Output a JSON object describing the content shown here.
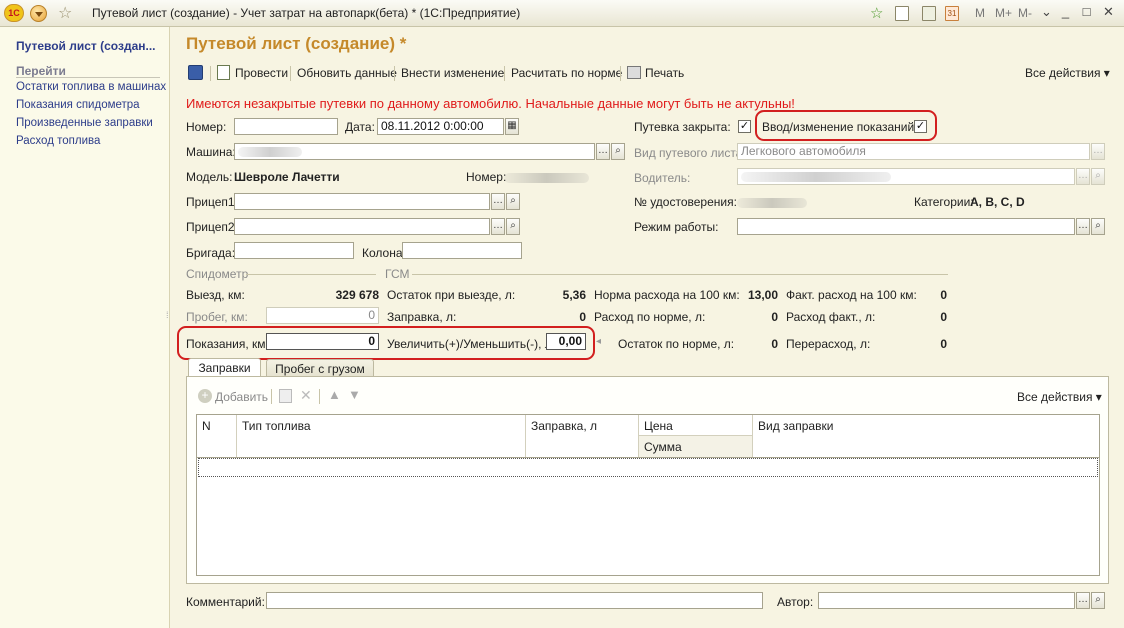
{
  "window": {
    "title": "Путевой лист (создание) - Учет затрат на автопарк(бета) *  (1С:Предприятие)",
    "logo": "1С",
    "right_icons": [
      "M",
      "M+",
      "M-"
    ]
  },
  "left_panel": {
    "current": "Путевой лист (создан...",
    "goto_header": "Перейти",
    "links": [
      "Остатки топлива в машинах",
      "Показания спидометра",
      "Произведенные заправки",
      "Расход топлива"
    ]
  },
  "form": {
    "title": "Путевой лист (создание) *",
    "toolbar": {
      "post": "Провести",
      "refresh": "Обновить данные",
      "change": "Внести изменение",
      "calc": "Расчитать по норме",
      "print": "Печать",
      "all_actions": "Все действия ▾"
    },
    "warning": "Имеются незакрытые путевки по данному автомобилю. Начальные данные могут быть не актульны!",
    "fields": {
      "number_label": "Номер:",
      "number_value": "",
      "date_label": "Дата:",
      "date_value": "08.11.2012  0:00:00",
      "closed_label": "Путевка закрыта:",
      "input_change_label": "Ввод/изменение показаний:",
      "car_label": "Машина:",
      "sheet_type_label": "Вид путевого листа:",
      "sheet_type_value": "Легкового автомобиля",
      "model_label": "Модель:",
      "model_value": "Шевроле Лачетти",
      "model_number_label": "Номер:",
      "driver_label": "Водитель:",
      "trailer1_label": "Прицеп1:",
      "trailer2_label": "Прицеп2:",
      "license_label": "№ удостоверения:",
      "categories_label": "Категории:",
      "categories_value": "A, B, C, D",
      "work_mode_label": "Режим работы:",
      "brigade_label": "Бригада:",
      "column_label": "Колона:"
    },
    "speedometer": {
      "header": "Спидометр",
      "departure_label": "Выезд, км:",
      "departure_value": "329 678",
      "mileage_label": "Пробег, км:",
      "mileage_value": "0",
      "reading_label": "Показания, км:",
      "reading_value": "0"
    },
    "gsm": {
      "header": "ГСМ",
      "rest_label": "Остаток при выезде, л:",
      "rest_value": "5,36",
      "fuel_label": "Заправка, л:",
      "fuel_value": "0",
      "incdec_label": "Увеличить(+)/Уменьшить(-), л:",
      "incdec_value": "0,00",
      "norm100_label": "Норма расхода на 100 км:",
      "norm100_value": "13,00",
      "bynorm_label": "Расход по норме, л:",
      "bynorm_value": "0",
      "restnorm_label": "Остаток по норме, л:",
      "restnorm_value": "0",
      "fact100_label": "Факт. расход на 100 км:",
      "fact100_value": "0",
      "fact_label": "Расход факт., л:",
      "fact_value": "0",
      "over_label": "Перерасход, л:",
      "over_value": "0"
    },
    "tabs": [
      "Заправки",
      "Пробег с грузом"
    ],
    "table": {
      "add_label": "Добавить",
      "all_actions": "Все действия ▾",
      "columns": {
        "n": "N",
        "fuel_type": "Тип топлива",
        "fuel_l": "Заправка, л",
        "price": "Цена",
        "sum": "Сумма",
        "kind": "Вид заправки"
      }
    },
    "comment_label": "Комментарий:",
    "author_label": "Автор:"
  }
}
